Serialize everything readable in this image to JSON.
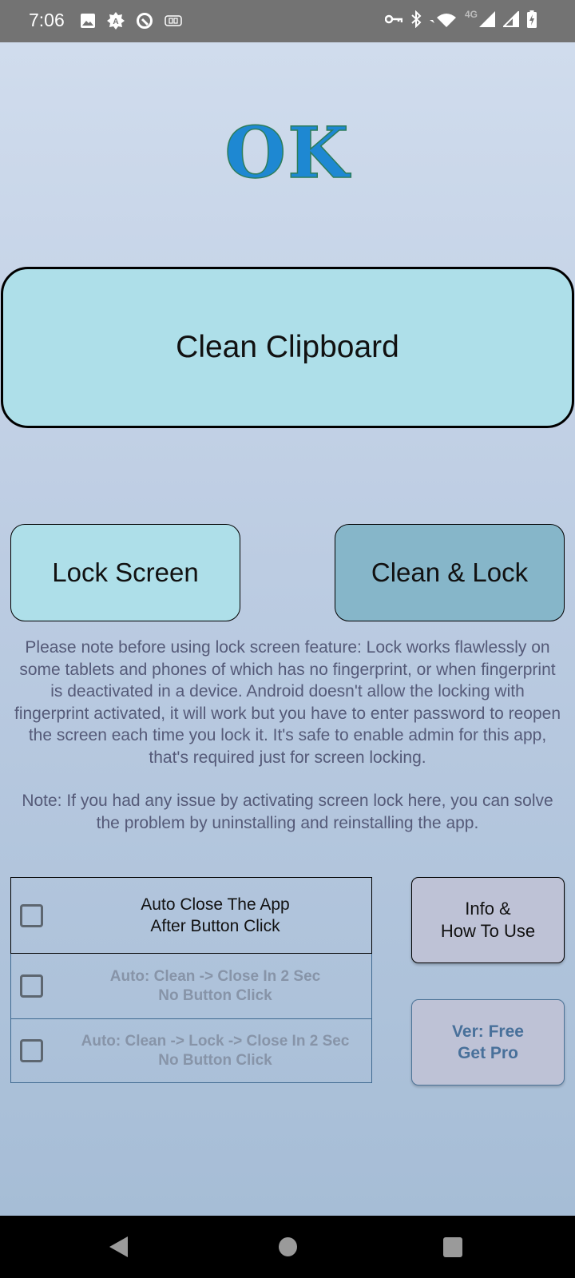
{
  "status_bar": {
    "time": "7:06",
    "left_icons": [
      "image-icon",
      "auto-brightness-icon",
      "sync-icon",
      "link-icon"
    ],
    "right_icons": [
      "vpn-key-icon",
      "bluetooth-icon",
      "wifi-icon",
      "4g-icon",
      "signal-icon",
      "signal-icon-2",
      "battery-charging-icon"
    ],
    "network_label": "4G"
  },
  "app": {
    "status_title": "OK",
    "buttons": {
      "clean_clipboard": "Clean Clipboard",
      "lock_screen": "Lock Screen",
      "clean_and_lock": "Clean & Lock",
      "info_line1": "Info &",
      "info_line2": "How To Use",
      "pro_line1": "Ver: Free",
      "pro_line2": "Get Pro"
    },
    "notice": {
      "paragraph1": "Please note before using lock screen feature: Lock works flawlessly on some tablets and phones of which has no fingerprint, or when fingerprint is deactivated in a device. Android doesn't allow the locking with fingerprint activated, it will work but you have to enter password to reopen the screen each time you lock it. It's safe to enable admin for this app, that's required just for screen locking.",
      "paragraph2": "Note: If you had any issue by activating screen lock here, you can solve the problem by uninstalling and reinstalling the app."
    },
    "options": [
      {
        "line1": "Auto Close The App",
        "line2": "After Button Click",
        "checked": false,
        "enabled": true
      },
      {
        "line1": "Auto: Clean -> Close In 2 Sec",
        "line2": "No Button Click",
        "checked": false,
        "enabled": false
      },
      {
        "line1": "Auto: Clean -> Lock -> Close In 2 Sec",
        "line2": "No Button Click",
        "checked": false,
        "enabled": false
      }
    ],
    "colors": {
      "title": "#1e88d2",
      "primary_button": "#aedfe9",
      "secondary_button": "#86b6c9",
      "info_button": "#bec2d6",
      "pro_text": "#48709a"
    }
  },
  "nav_bar": {
    "buttons": [
      "back",
      "home",
      "recents"
    ]
  }
}
